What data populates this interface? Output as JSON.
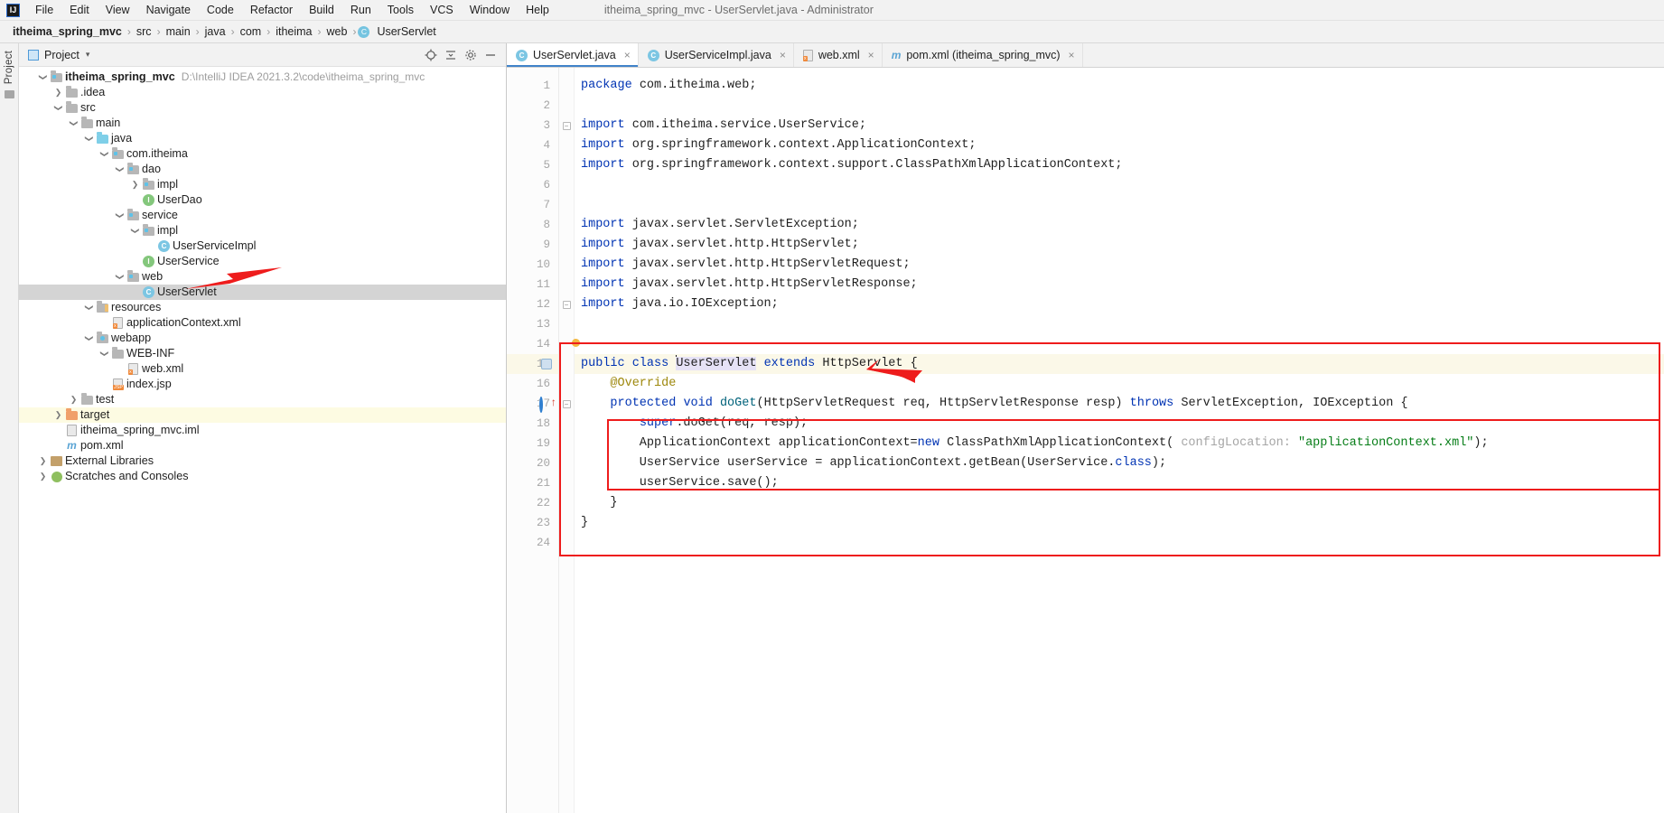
{
  "window": {
    "title": "itheima_spring_mvc - UserServlet.java - Administrator",
    "logo": "IJ"
  },
  "menu": [
    {
      "label": "File"
    },
    {
      "label": "Edit"
    },
    {
      "label": "View"
    },
    {
      "label": "Navigate"
    },
    {
      "label": "Code"
    },
    {
      "label": "Refactor"
    },
    {
      "label": "Build"
    },
    {
      "label": "Run"
    },
    {
      "label": "Tools"
    },
    {
      "label": "VCS"
    },
    {
      "label": "Window"
    },
    {
      "label": "Help"
    }
  ],
  "breadcrumb": {
    "items": [
      "itheima_spring_mvc",
      "src",
      "main",
      "java",
      "com",
      "itheima",
      "web",
      "UserServlet"
    ],
    "last_icon": "C",
    "separator": "›"
  },
  "toolstrip": {
    "project_label": "Project"
  },
  "project_panel": {
    "header_title": "Project",
    "caret": "▾",
    "icons": [
      "target-icon",
      "collapse-all-icon",
      "settings-gear-icon",
      "hide-icon"
    ],
    "tree": [
      {
        "depth": 0,
        "twist": "⌄",
        "icon": "module-folder-icon",
        "label": "itheima_spring_mvc",
        "bold": true,
        "path": "D:\\IntelliJ IDEA 2021.3.2\\code\\itheima_spring_mvc"
      },
      {
        "depth": 1,
        "twist": "›",
        "icon": "folder-icon",
        "label": ".idea"
      },
      {
        "depth": 1,
        "twist": "⌄",
        "icon": "folder-icon",
        "label": "src"
      },
      {
        "depth": 2,
        "twist": "⌄",
        "icon": "folder-icon",
        "label": "main"
      },
      {
        "depth": 3,
        "twist": "⌄",
        "icon": "source-folder-icon",
        "label": "java"
      },
      {
        "depth": 4,
        "twist": "⌄",
        "icon": "package-icon",
        "label": "com.itheima"
      },
      {
        "depth": 5,
        "twist": "⌄",
        "icon": "package-icon",
        "label": "dao"
      },
      {
        "depth": 6,
        "twist": "›",
        "icon": "package-icon",
        "label": "impl"
      },
      {
        "depth": 6,
        "twist": "",
        "icon": "interface-icon",
        "label": "UserDao"
      },
      {
        "depth": 5,
        "twist": "⌄",
        "icon": "package-icon",
        "label": "service"
      },
      {
        "depth": 6,
        "twist": "⌄",
        "icon": "package-icon",
        "label": "impl"
      },
      {
        "depth": 7,
        "twist": "",
        "icon": "class-icon",
        "label": "UserServiceImpl"
      },
      {
        "depth": 6,
        "twist": "",
        "icon": "interface-icon",
        "label": "UserService"
      },
      {
        "depth": 5,
        "twist": "⌄",
        "icon": "package-icon",
        "label": "web"
      },
      {
        "depth": 6,
        "twist": "",
        "icon": "class-icon",
        "label": "UserServlet",
        "selected": true
      },
      {
        "depth": 3,
        "twist": "⌄",
        "icon": "resources-folder-icon",
        "label": "resources"
      },
      {
        "depth": 4,
        "twist": "",
        "icon": "xml-file-icon",
        "label": "applicationContext.xml"
      },
      {
        "depth": 3,
        "twist": "⌄",
        "icon": "webapp-folder-icon",
        "label": "webapp"
      },
      {
        "depth": 4,
        "twist": "⌄",
        "icon": "folder-icon",
        "label": "WEB-INF"
      },
      {
        "depth": 5,
        "twist": "",
        "icon": "xml-file-icon",
        "label": "web.xml"
      },
      {
        "depth": 4,
        "twist": "",
        "icon": "jsp-file-icon",
        "label": "index.jsp"
      },
      {
        "depth": 2,
        "twist": "›",
        "icon": "folder-icon",
        "label": "test"
      },
      {
        "depth": 1,
        "twist": "›",
        "icon": "target-folder-icon",
        "label": "target",
        "target": true
      },
      {
        "depth": 1,
        "twist": "",
        "icon": "iml-file-icon",
        "label": "itheima_spring_mvc.iml"
      },
      {
        "depth": 1,
        "twist": "",
        "icon": "maven-file-icon",
        "label": "pom.xml"
      },
      {
        "depth": 0,
        "twist": "›",
        "icon": "library-icon",
        "label": "External Libraries"
      },
      {
        "depth": 0,
        "twist": "›",
        "icon": "scratches-icon",
        "label": "Scratches and Consoles"
      }
    ]
  },
  "editor": {
    "tabs": [
      {
        "label": "UserServlet.java",
        "icon": "class-icon",
        "active": true,
        "close": "×"
      },
      {
        "label": "UserServiceImpl.java",
        "icon": "class-icon",
        "active": false,
        "close": "×"
      },
      {
        "label": "web.xml",
        "icon": "xml-file-icon",
        "active": false,
        "close": "×"
      },
      {
        "label": "pom.xml (itheima_spring_mvc)",
        "icon": "maven-file-icon",
        "active": false,
        "close": "×"
      }
    ],
    "line_numbers": [
      1,
      2,
      3,
      4,
      5,
      6,
      7,
      8,
      9,
      10,
      11,
      12,
      13,
      14,
      15,
      16,
      17,
      18,
      19,
      20,
      21,
      22,
      23,
      24
    ],
    "code_lines": [
      {
        "n": 1,
        "html": "<span class=\"kw\">package</span> com.itheima.web;"
      },
      {
        "n": 2,
        "html": ""
      },
      {
        "n": 3,
        "html": "<span class=\"kw\">import</span> com.itheima.service.UserService;",
        "fold": true
      },
      {
        "n": 4,
        "html": "<span class=\"kw\">import</span> org.springframework.context.ApplicationContext;"
      },
      {
        "n": 5,
        "html": "<span class=\"kw\">import</span> org.springframework.context.support.ClassPathXmlApplicationContext;"
      },
      {
        "n": 6,
        "html": ""
      },
      {
        "n": 7,
        "html": ""
      },
      {
        "n": 8,
        "html": "<span class=\"kw\">import</span> javax.servlet.ServletException;"
      },
      {
        "n": 9,
        "html": "<span class=\"kw\">import</span> javax.servlet.http.HttpServlet;"
      },
      {
        "n": 10,
        "html": "<span class=\"kw\">import</span> javax.servlet.http.HttpServletRequest;"
      },
      {
        "n": 11,
        "html": "<span class=\"kw\">import</span> javax.servlet.http.HttpServletResponse;"
      },
      {
        "n": 12,
        "html": "<span class=\"kw\">import</span> java.io.IOException;",
        "fold": true
      },
      {
        "n": 13,
        "html": ""
      },
      {
        "n": 14,
        "html": ""
      },
      {
        "n": 15,
        "html": "<span class=\"kw\">public class</span> <span class=\"caret-bar\"></span><span class=\"sel\">UserServlet</span> <span class=\"kw\">extends</span> HttpServlet {",
        "hl": true
      },
      {
        "n": 16,
        "html": "    <span class=\"anno\">@Override</span>"
      },
      {
        "n": 17,
        "html": "    <span class=\"kw\">protected</span> <span class=\"kw\">void</span> <span class=\"mth\">doGet</span>(HttpServletRequest req, HttpServletResponse resp) <span class=\"kw\">throws</span> ServletException, IOException {",
        "fold": true
      },
      {
        "n": 18,
        "html": "        <span class=\"kw\">super</span>.doGet(req, resp);"
      },
      {
        "n": 19,
        "html": "        ApplicationContext applicationContext=<span class=\"kw\">new</span> ClassPathXmlApplicationContext( <span class=\"hint\">configLocation:</span> <span class=\"str\">\"applicationContext.xml\"</span>);"
      },
      {
        "n": 20,
        "html": "        UserService userService = applicationContext.getBean(UserService.<span class=\"kw\">class</span>);"
      },
      {
        "n": 21,
        "html": "        userService.save();"
      },
      {
        "n": 22,
        "html": "    }"
      },
      {
        "n": 23,
        "html": "}"
      },
      {
        "n": 24,
        "html": ""
      }
    ],
    "plain_code": [
      "package com.itheima.web;",
      "",
      "import com.itheima.service.UserService;",
      "import org.springframework.context.ApplicationContext;",
      "import org.springframework.context.support.ClassPathXmlApplicationContext;",
      "",
      "",
      "import javax.servlet.ServletException;",
      "import javax.servlet.http.HttpServlet;",
      "import javax.servlet.http.HttpServletRequest;",
      "import javax.servlet.http.HttpServletResponse;",
      "import java.io.IOException;",
      "",
      "",
      "public class UserServlet extends HttpServlet {",
      "    @Override",
      "    protected void doGet(HttpServletRequest req, HttpServletResponse resp) throws ServletException, IOException {",
      "        super.doGet(req, resp);",
      "        ApplicationContext applicationContext=new ClassPathXmlApplicationContext( configLocation: \"applicationContext.xml\");",
      "        UserService userService = applicationContext.getBean(UserService.class);",
      "        userService.save();",
      "    }",
      "}",
      ""
    ]
  },
  "annotations": {
    "arrow_color": "#ee1c1c",
    "box_color": "#ee1c1c",
    "arrows": [
      {
        "name": "arrow-to-userservlet-tree"
      },
      {
        "name": "arrow-to-class-declaration"
      }
    ],
    "boxes": [
      {
        "name": "outer-highlight-box"
      },
      {
        "name": "inner-highlight-box"
      }
    ]
  },
  "colors": {
    "accent": "#4083c9",
    "keyword": "#0033b3",
    "string": "#067d17",
    "annotation": "#9e880d",
    "method": "#00627a",
    "selection_bg": "#d4d4d4",
    "current_line_bg": "#fbf8e8",
    "panel_bg": "#f2f2f2"
  }
}
